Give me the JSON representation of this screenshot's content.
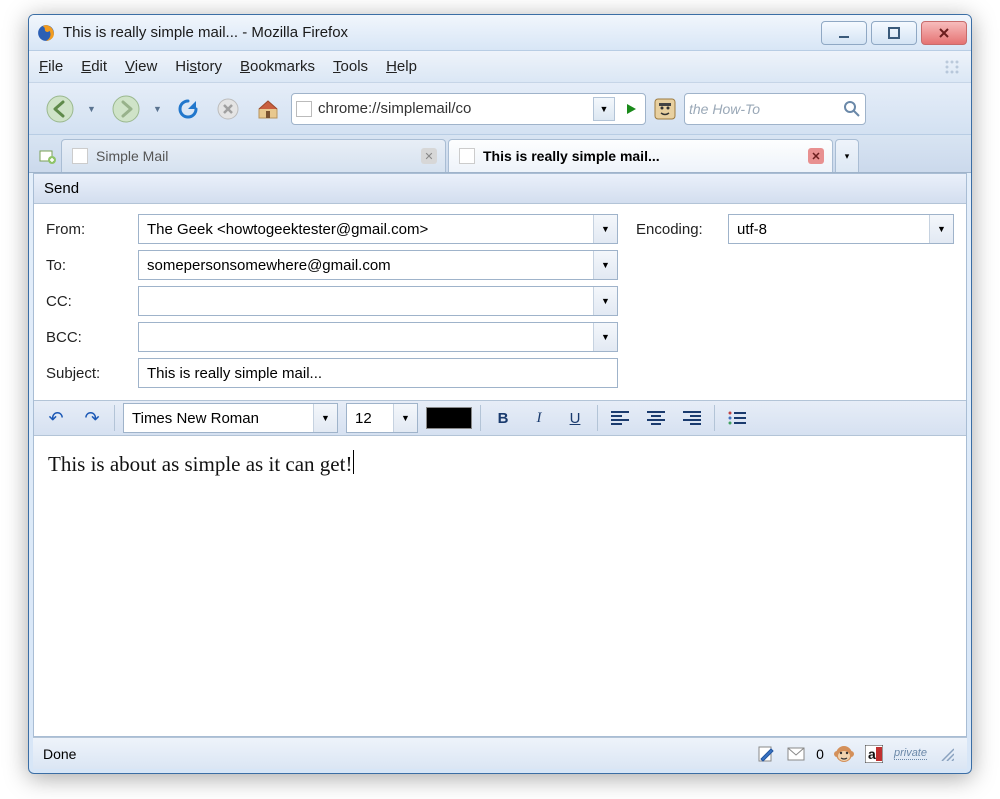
{
  "window": {
    "title": "This is really simple mail... - Mozilla Firefox"
  },
  "menu": {
    "file": "File",
    "edit": "Edit",
    "view": "View",
    "history": "History",
    "bookmarks": "Bookmarks",
    "tools": "Tools",
    "help": "Help"
  },
  "nav": {
    "url": "chrome://simplemail/co",
    "search_placeholder": "the How-To"
  },
  "tabs": {
    "tab1": "Simple Mail",
    "tab2": "This is really simple mail..."
  },
  "compose": {
    "send": "Send",
    "from_label": "From:",
    "from_value": "The Geek <howtogeektester@gmail.com>",
    "to_label": "To:",
    "to_value": "somepersonsomewhere@gmail.com",
    "cc_label": "CC:",
    "cc_value": "",
    "bcc_label": "BCC:",
    "bcc_value": "",
    "subject_label": "Subject:",
    "subject_value": "This is really simple mail...",
    "encoding_label": "Encoding:",
    "encoding_value": "utf-8"
  },
  "format": {
    "font": "Times New Roman",
    "size": "12",
    "bold": "B",
    "italic": "I",
    "underline": "U"
  },
  "body": {
    "text": "This is about as simple as it can get!"
  },
  "status": {
    "done": "Done",
    "inbox_count": "0",
    "private": "private"
  }
}
